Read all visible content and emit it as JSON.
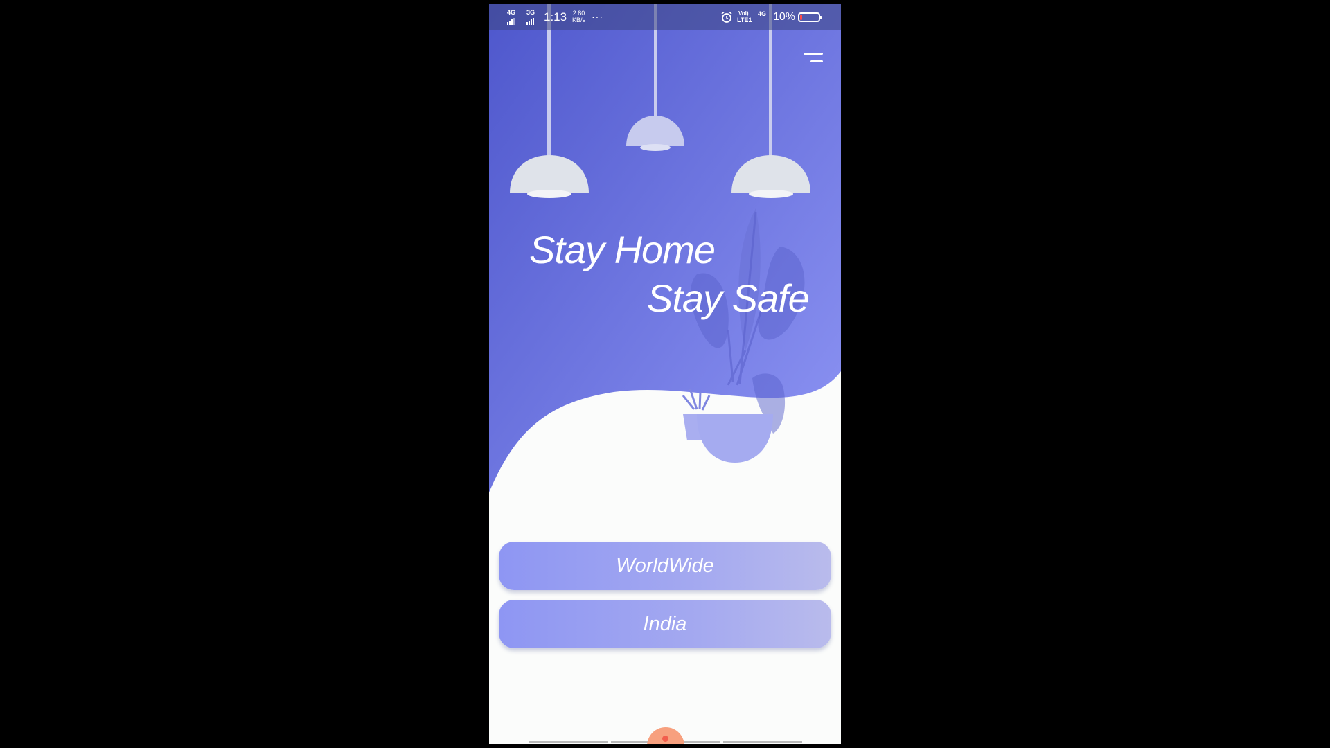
{
  "status_bar": {
    "network_1": "4G",
    "network_2": "3G",
    "time": "1:13",
    "speed_value": "2.80",
    "speed_unit": "KB/s",
    "more": "···",
    "volte_top": "Vol)",
    "volte_bottom": "LTE1",
    "network_3": "4G",
    "battery_percent": "10%",
    "battery_level": 0.1,
    "battery_color": "#ff4a4a",
    "icons": [
      "signal-icon",
      "alarm-icon",
      "battery-icon"
    ]
  },
  "header": {
    "menu_icon": "hamburger-menu-icon"
  },
  "hero": {
    "headline_line1": "Stay Home",
    "headline_line2": "Stay Safe",
    "gradient_start": "#4e57cc",
    "gradient_end": "#8990f1",
    "illustration": [
      "pendant-lamp-icon",
      "pendant-lamp-icon",
      "pendant-lamp-icon",
      "potted-plant-icon"
    ]
  },
  "actions": {
    "worldwide_label": "WorldWide",
    "india_label": "India"
  },
  "colors": {
    "accent": "#8e96f3",
    "background": "#fbfcfb",
    "nav_handle": "#f7a07e"
  }
}
